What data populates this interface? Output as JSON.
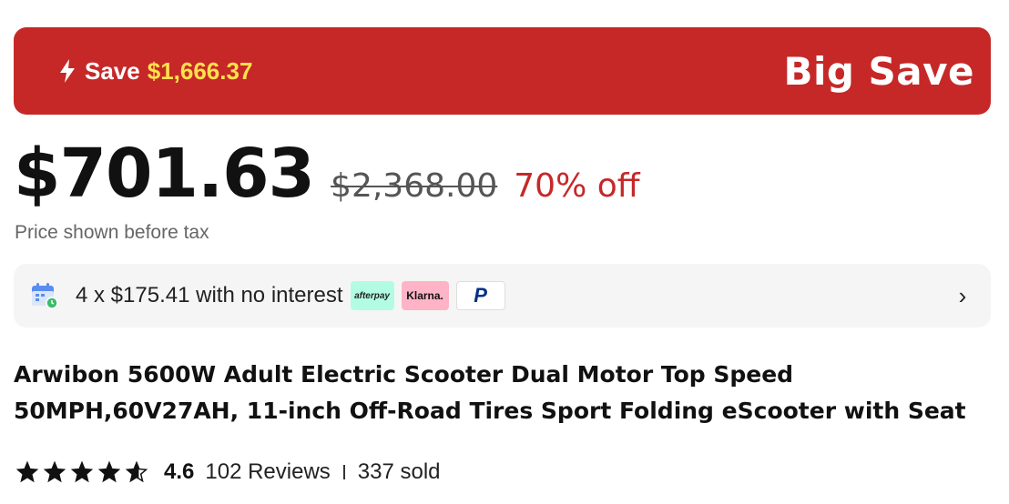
{
  "banner": {
    "save_label": "Save",
    "save_amount": "$1,666.37",
    "big_save": "Big Save",
    "bg_color": "#c62828",
    "amount_color": "#ffe14d",
    "icon": "bolt-icon"
  },
  "price": {
    "current": "$701.63",
    "original": "$2,368.00",
    "discount": "70% off",
    "tax_note": "Price shown before tax"
  },
  "installment": {
    "icon": "calendar-icon",
    "text": "4 x $175.41 with no interest",
    "providers": [
      "afterpay",
      "Klarna.",
      "P"
    ],
    "chevron": "›"
  },
  "product": {
    "title": "Arwibon 5600W Adult Electric Scooter Dual Motor Top Speed 50MPH,60V27AH, 11-inch Off-Road Tires Sport Folding eScooter with Seat"
  },
  "rating": {
    "value": "4.6",
    "stars": 4.6,
    "reviews": "102 Reviews",
    "sold": "337 sold"
  }
}
